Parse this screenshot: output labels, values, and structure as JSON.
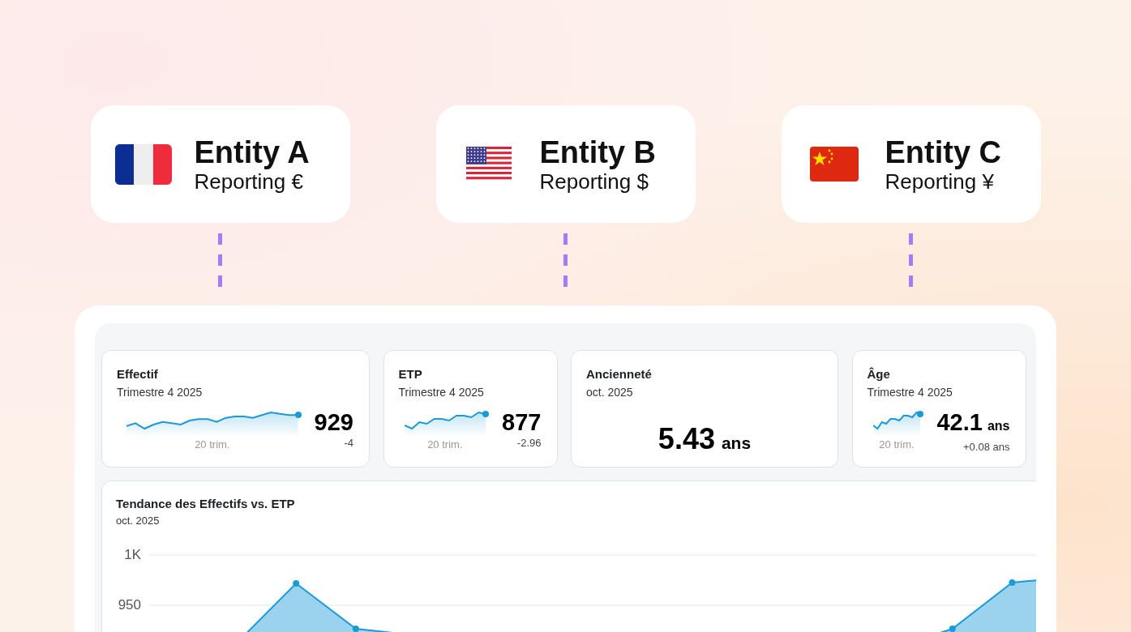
{
  "entities": [
    {
      "name": "Entity A",
      "reporting": "Reporting €",
      "kind": "france"
    },
    {
      "name": "Entity B",
      "reporting": "Reporting $",
      "kind": "usa"
    },
    {
      "name": "Entity C",
      "reporting": "Reporting ¥",
      "kind": "china"
    }
  ],
  "kpis": [
    {
      "kind": "trend",
      "title": "Effectif",
      "period": "Trimestre 4 2025",
      "span": "20 trim.",
      "value": "929",
      "delta": "-4"
    },
    {
      "kind": "trend",
      "title": "ETP",
      "period": "Trimestre 4 2025",
      "span": "20 trim.",
      "value": "877",
      "delta": "-2.96"
    },
    {
      "kind": "big",
      "title": "Ancienneté",
      "period": "oct. 2025",
      "value": "5.43",
      "unit": "ans"
    },
    {
      "kind": "trend",
      "title": "Âge",
      "period": "Trimestre 4 2025",
      "span": "20 trim.",
      "value": "42.1",
      "unit": "ans",
      "delta": "+0.08 ans"
    }
  ],
  "chart": {
    "title": "Tendance des Effectifs vs. ETP",
    "period": "oct. 2025",
    "y_ticks": [
      "1K",
      "950"
    ]
  }
}
